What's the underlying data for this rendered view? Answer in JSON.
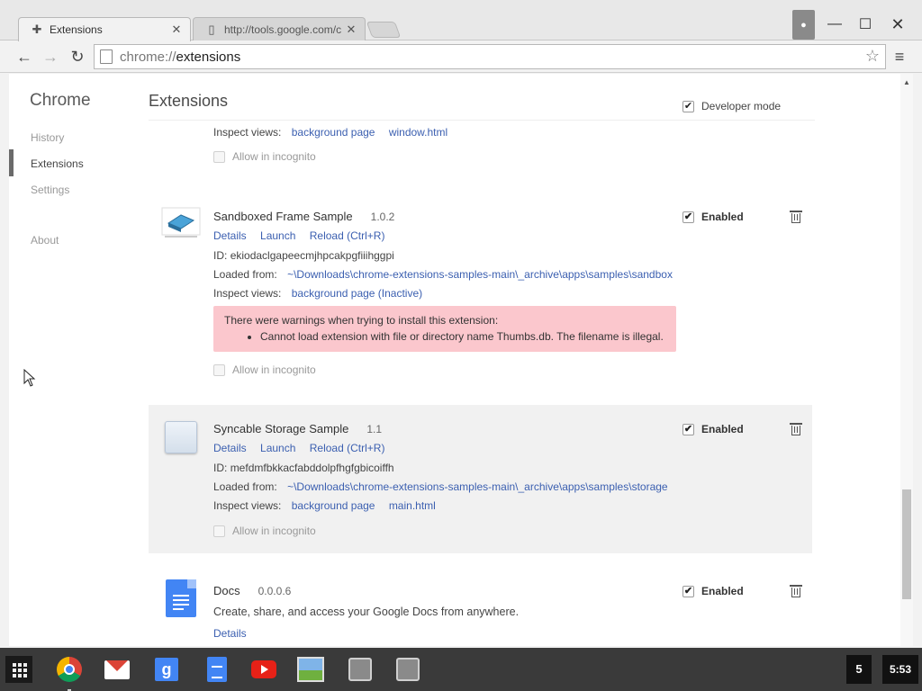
{
  "tabs": [
    {
      "title": "Extensions",
      "icon": "puzzle-icon",
      "active": true
    },
    {
      "title": "http://tools.google.com/c",
      "icon": "page-icon",
      "active": false
    }
  ],
  "address_bar": {
    "scheme": "chrome://",
    "host": "extensions"
  },
  "sidebar": {
    "brand": "Chrome",
    "items": [
      "History",
      "Extensions",
      "Settings",
      "About"
    ],
    "active": "Extensions"
  },
  "main": {
    "title": "Extensions",
    "developer_mode": {
      "label": "Developer mode",
      "checked": true
    }
  },
  "labels": {
    "inspect_views": "Inspect views:",
    "allow_incognito": "Allow in incognito",
    "id_prefix": "ID:",
    "loaded_from": "Loaded from:",
    "enabled": "Enabled"
  },
  "extensions": [
    {
      "partial": true,
      "inspect_views": [
        "background page",
        "window.html"
      ]
    },
    {
      "name": "Sandboxed Frame Sample",
      "version": "1.0.2",
      "actions": [
        "Details",
        "Launch",
        "Reload (Ctrl+R)"
      ],
      "id": "ekiodaclgapeecmjhpcakpgfiiihggpi",
      "loaded_from": "~\\Downloads\\chrome-extensions-samples-main\\_archive\\apps\\samples\\sandbox",
      "inspect_views": [
        "background page (Inactive)"
      ],
      "warning": {
        "heading": "There were warnings when trying to install this extension:",
        "items": [
          "Cannot load extension with file or directory name Thumbs.db. The filename is illegal."
        ]
      },
      "enabled": true
    },
    {
      "name": "Syncable Storage Sample",
      "version": "1.1",
      "actions": [
        "Details",
        "Launch",
        "Reload (Ctrl+R)"
      ],
      "id": "mefdmfbkkacfabddolpfhgfgbicoiffh",
      "loaded_from": "~\\Downloads\\chrome-extensions-samples-main\\_archive\\apps\\samples\\storage",
      "inspect_views": [
        "background page",
        "main.html"
      ],
      "enabled": true
    },
    {
      "name": "Docs",
      "version": "0.0.0.6",
      "description": "Create, share, and access your Google Docs from anywhere.",
      "actions": [
        "Details"
      ],
      "enabled": true
    }
  ],
  "shelf": {
    "apps": [
      "chrome-icon",
      "gmail-icon",
      "google-search-icon",
      "docs-icon",
      "youtube-icon",
      "photos-icon",
      "extension-app-icon",
      "extension-app-icon"
    ],
    "notification_count": "5",
    "clock": "5:53"
  }
}
